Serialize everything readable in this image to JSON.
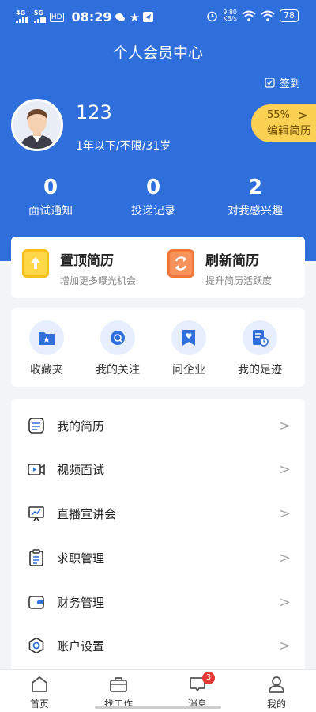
{
  "status_bar": {
    "net1": "4G+",
    "net2": "5G",
    "hd": "HD",
    "time": "08:29",
    "speed_value": "9.80",
    "speed_unit": "KB/s",
    "battery": "78"
  },
  "header": {
    "title": "个人会员中心",
    "signin_label": "签到",
    "user_name": "123",
    "user_info": "1年以下/不限/31岁",
    "resume_percent": "55%",
    "resume_label": "编辑简历",
    "resume_arrow": ">"
  },
  "stats": [
    {
      "value": "0",
      "label": "面试通知"
    },
    {
      "value": "0",
      "label": "投递记录"
    },
    {
      "value": "2",
      "label": "对我感兴趣"
    }
  ],
  "promo": [
    {
      "title": "置顶简历",
      "subtitle": "增加更多曝光机会",
      "color": "#f5c018",
      "icon": "upload-icon"
    },
    {
      "title": "刷新简历",
      "subtitle": "提升简历活跃度",
      "color": "#f2763a",
      "icon": "refresh-icon"
    }
  ],
  "shortcuts": [
    {
      "label": "收藏夹",
      "icon": "favorites-folder-icon"
    },
    {
      "label": "我的关注",
      "icon": "follow-icon"
    },
    {
      "label": "问企业",
      "icon": "bookmark-icon"
    },
    {
      "label": "我的足迹",
      "icon": "history-icon"
    }
  ],
  "menu": [
    {
      "label": "我的简历",
      "icon": "resume-icon"
    },
    {
      "label": "视频面试",
      "icon": "video-icon"
    },
    {
      "label": "直播宣讲会",
      "icon": "live-presentation-icon"
    },
    {
      "label": "求职管理",
      "icon": "job-management-icon"
    },
    {
      "label": "财务管理",
      "icon": "wallet-icon"
    },
    {
      "label": "账户设置",
      "icon": "settings-icon"
    }
  ],
  "menu_chevron": ">",
  "tabs": [
    {
      "label": "首页",
      "icon": "home-icon"
    },
    {
      "label": "找工作",
      "icon": "briefcase-icon"
    },
    {
      "label": "消息",
      "icon": "message-icon",
      "badge": "3"
    },
    {
      "label": "我的",
      "icon": "profile-icon"
    }
  ],
  "colors": {
    "primary": "#2f6fdc",
    "accent_yellow": "#fbd154",
    "badge_red": "#e53935"
  }
}
